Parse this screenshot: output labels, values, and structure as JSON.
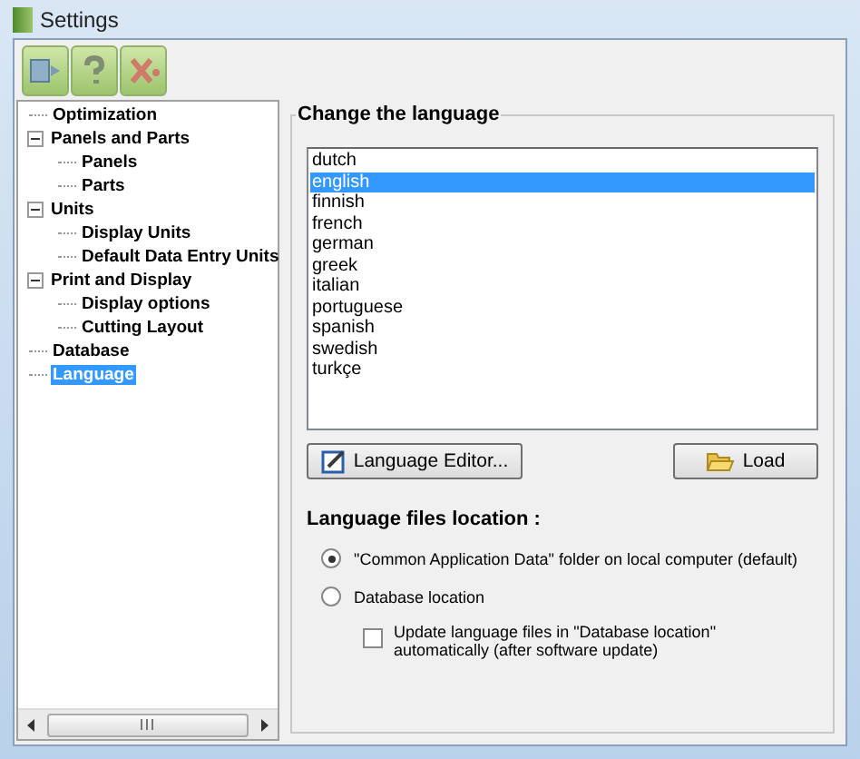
{
  "window": {
    "title": "Settings"
  },
  "toolbar": {
    "buttons": [
      {
        "kind": "export"
      },
      {
        "kind": "help"
      },
      {
        "kind": "close"
      }
    ]
  },
  "tree": [
    {
      "label": "Optimization",
      "selected": false
    },
    {
      "label": "Panels and Parts",
      "selected": false,
      "expanded": true,
      "children": [
        {
          "label": "Panels",
          "selected": false
        },
        {
          "label": "Parts",
          "selected": false
        }
      ]
    },
    {
      "label": "Units",
      "selected": false,
      "expanded": true,
      "children": [
        {
          "label": "Display Units",
          "selected": false
        },
        {
          "label": "Default Data Entry Units",
          "selected": false
        }
      ]
    },
    {
      "label": "Print and Display",
      "selected": false,
      "expanded": true,
      "children": [
        {
          "label": "Display options",
          "selected": false
        },
        {
          "label": "Cutting Layout",
          "selected": false
        }
      ]
    },
    {
      "label": "Database",
      "selected": false
    },
    {
      "label": "Language",
      "selected": true
    }
  ],
  "group": {
    "title": "Change the language",
    "languages": [
      {
        "label": "dutch",
        "selected": false
      },
      {
        "label": "english",
        "selected": true
      },
      {
        "label": "finnish",
        "selected": false
      },
      {
        "label": "french",
        "selected": false
      },
      {
        "label": "german",
        "selected": false
      },
      {
        "label": "greek",
        "selected": false
      },
      {
        "label": "italian",
        "selected": false
      },
      {
        "label": "portuguese",
        "selected": false
      },
      {
        "label": "spanish",
        "selected": false
      },
      {
        "label": "swedish",
        "selected": false
      },
      {
        "label": "turkçe",
        "selected": false
      }
    ],
    "buttons": [
      {
        "label": "Language Editor...",
        "kind": "editor"
      },
      {
        "label": "Load",
        "kind": "load"
      }
    ],
    "location_title": "Language files location :",
    "options": [
      {
        "label": "\"Common Application Data\" folder on local computer (default)",
        "selected": true
      },
      {
        "label": "Database location",
        "selected": false
      }
    ],
    "auto_update": {
      "label": "Update language files in \"Database location\" automatically (after software update)",
      "checked": false
    }
  }
}
